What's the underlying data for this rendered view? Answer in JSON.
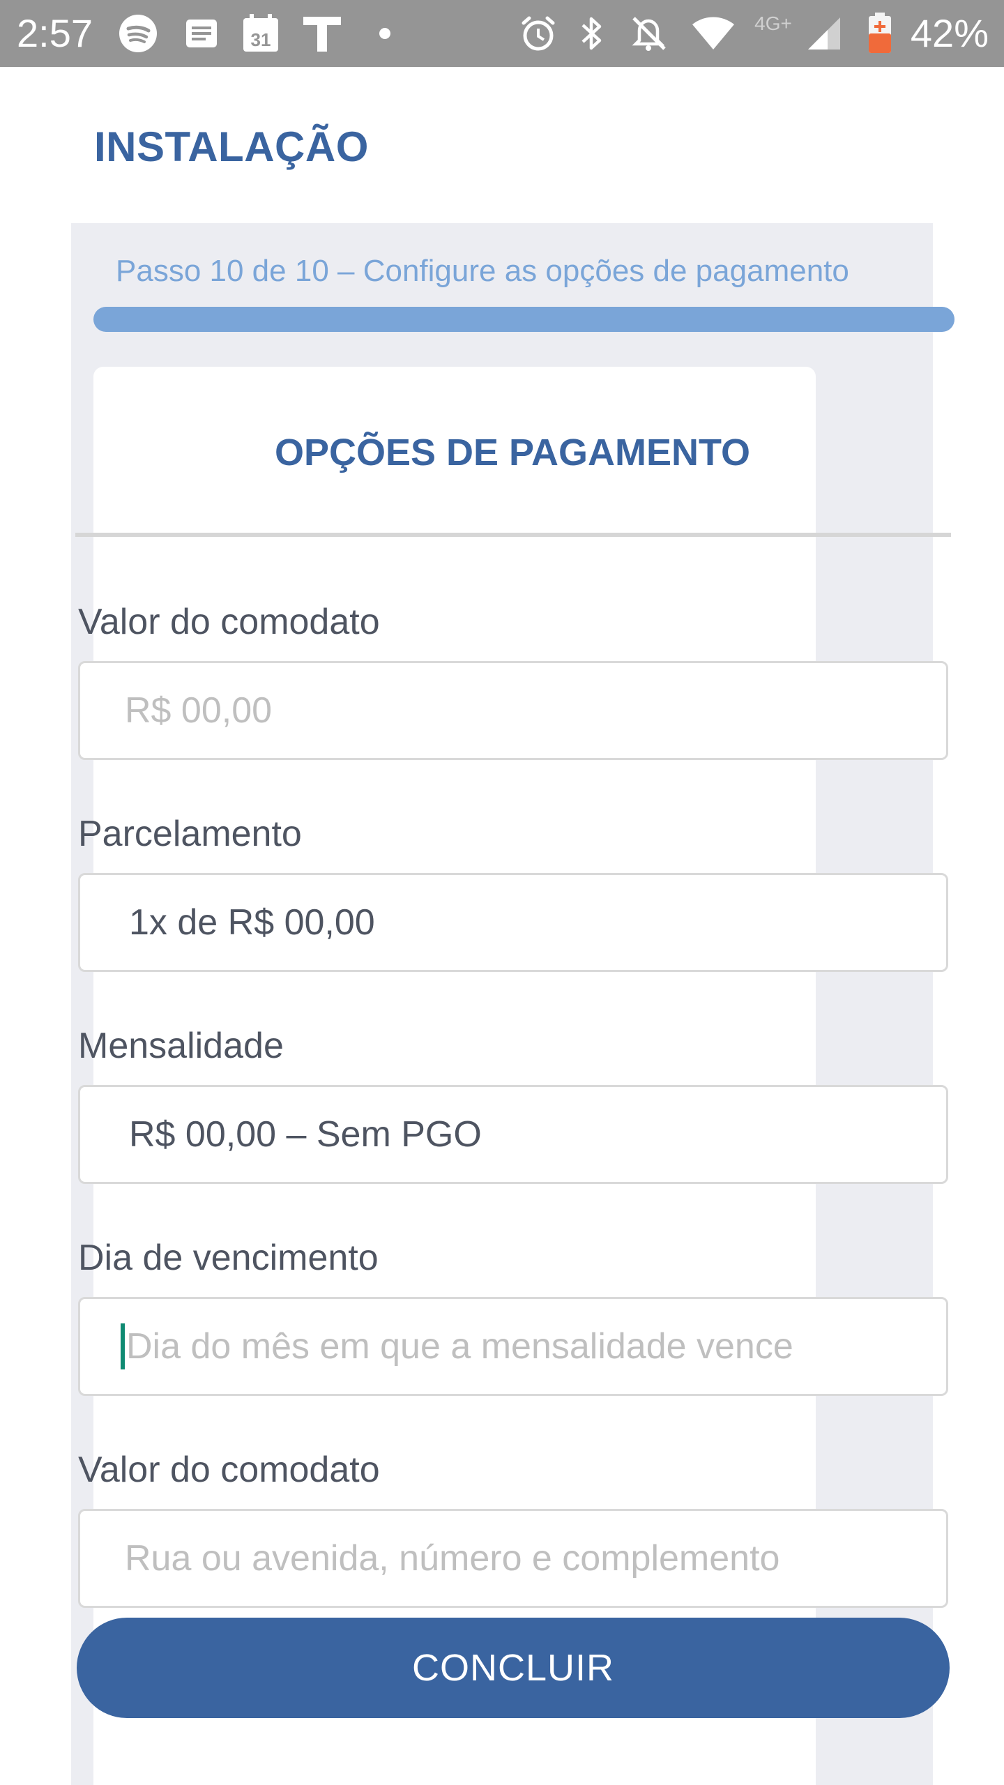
{
  "status_bar": {
    "time": "2:57",
    "battery_percent": "42%",
    "network_label": "4G+",
    "calendar_day": "31",
    "icons": [
      "spotify-icon",
      "news-icon",
      "calendar-icon",
      "t-app-icon",
      "dot-icon",
      "alarm-icon",
      "bluetooth-icon",
      "mute-icon",
      "wifi-icon",
      "signal-icon",
      "battery-icon"
    ]
  },
  "app": {
    "title": "INSTALAÇÃO"
  },
  "step": {
    "text": "Passo 10 de 10 – Configure as opções de pagamento",
    "progress": 1.0
  },
  "card": {
    "title": "OPÇÕES DE PAGAMENTO"
  },
  "form": {
    "comodato": {
      "label": "Valor do comodato",
      "placeholder": "R$ 00,00"
    },
    "parcelamento": {
      "label": "Parcelamento",
      "value": "1x de R$ 00,00"
    },
    "mensalidade": {
      "label": "Mensalidade",
      "value": "R$ 00,00 – Sem PGO"
    },
    "vencimento": {
      "label": "Dia de vencimento",
      "placeholder": "Dia do mês em que a mensalidade vence"
    },
    "comodato2": {
      "label": "Valor do comodato",
      "placeholder": "Rua ou avenida, número e complemento"
    }
  },
  "actions": {
    "concluir_label": "CONCLUIR"
  },
  "colors": {
    "accent": "#3a64a0",
    "progress": "#7aa5d8",
    "panel_bg": "#ecedf2",
    "status_bar": "#959595"
  }
}
